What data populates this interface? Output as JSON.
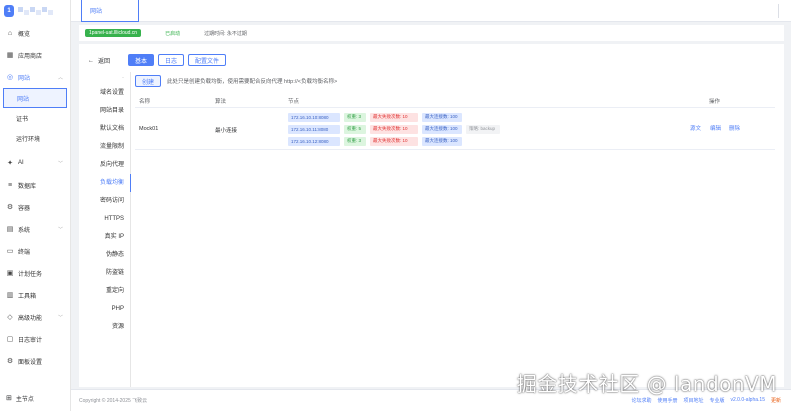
{
  "sidebar": {
    "logo_text": "1",
    "items": [
      {
        "label": "概览",
        "icon": "home-icon"
      },
      {
        "label": "应用商店",
        "icon": "grid-icon"
      },
      {
        "label": "网站",
        "icon": "globe-icon",
        "expanded": true
      }
    ],
    "sub_items": [
      {
        "label": "网站",
        "active": true
      },
      {
        "label": "证书",
        "active": false
      },
      {
        "label": "运行环境",
        "active": false
      }
    ],
    "items_after": [
      {
        "label": "AI",
        "icon": "ai-icon",
        "has_chevron": true
      },
      {
        "label": "数据库",
        "icon": "database-icon",
        "has_chevron": false
      },
      {
        "label": "容器",
        "icon": "container-icon",
        "has_chevron": false
      },
      {
        "label": "系统",
        "icon": "system-icon",
        "has_chevron": true
      },
      {
        "label": "终端",
        "icon": "terminal-icon",
        "has_chevron": false
      },
      {
        "label": "计划任务",
        "icon": "calendar-icon",
        "has_chevron": false
      },
      {
        "label": "工具箱",
        "icon": "toolbox-icon",
        "has_chevron": false
      },
      {
        "label": "高级功能",
        "icon": "diamond-icon",
        "has_chevron": true
      },
      {
        "label": "日志审计",
        "icon": "log-icon",
        "has_chevron": false
      },
      {
        "label": "面板设置",
        "icon": "settings-icon",
        "has_chevron": false
      }
    ],
    "node_label": "主节点"
  },
  "topbar": {
    "tab_label": "网站"
  },
  "infobar": {
    "site_name": "1panel-uat.lllicloud.cn",
    "status": "已启动",
    "expire": "过期时间: 永不过期"
  },
  "panel": {
    "back_label": "返回",
    "tabs": [
      {
        "label": "基本",
        "active": true
      },
      {
        "label": "日志",
        "active": false
      },
      {
        "label": "配置文件",
        "active": false
      }
    ],
    "menu_dot": "·",
    "menu": [
      {
        "label": "域名设置",
        "active": false
      },
      {
        "label": "网站目录",
        "active": false
      },
      {
        "label": "默认文档",
        "active": false
      },
      {
        "label": "流量限制",
        "active": false
      },
      {
        "label": "反向代理",
        "active": false
      },
      {
        "label": "负载均衡",
        "active": true
      },
      {
        "label": "密码访问",
        "active": false
      },
      {
        "label": "HTTPS",
        "active": false
      },
      {
        "label": "真实 IP",
        "active": false
      },
      {
        "label": "伪静态",
        "active": false
      },
      {
        "label": "防盗链",
        "active": false
      },
      {
        "label": "重定向",
        "active": false
      },
      {
        "label": "PHP",
        "active": false
      },
      {
        "label": "资源",
        "active": false
      }
    ],
    "create_button": "创建",
    "hint": "此处只是创建负载均衡，使用需要配合反向代理 http://<负载均衡名称>",
    "columns": {
      "name": "名称",
      "algorithm": "算法",
      "nodes": "节点",
      "actions": "操作"
    },
    "rows": [
      {
        "name": "Mock01",
        "algorithm": "最小连接",
        "nodes": [
          {
            "ip": "172.16.10.10:8080",
            "weight": "权重: 3",
            "max_fails": "最大失败次数: 10",
            "max_conns": "最大连接数: 100",
            "backup": ""
          },
          {
            "ip": "172.16.10.11:8080",
            "weight": "权重: 5",
            "max_fails": "最大失败次数: 10",
            "max_conns": "最大连接数: 100",
            "backup": "策略: backup"
          },
          {
            "ip": "172.16.10.12:8080",
            "weight": "权重: 3",
            "max_fails": "最大失败次数: 10",
            "max_conns": "最大连接数: 100",
            "backup": ""
          }
        ],
        "actions": [
          "源文",
          "编辑",
          "删除"
        ]
      }
    ]
  },
  "footer": {
    "copyright": "Copyright © 2014-2025 飞致云",
    "links": [
      "论坛求助",
      "使用手册",
      "项目地址",
      "专业版"
    ],
    "version": "v2.0.0-alpha.15",
    "update": "更新"
  },
  "watermark": "掘金技术社区 @ landonVM",
  "colors": {
    "accent": "#4f7ef7",
    "success": "#37b24d",
    "danger": "#e03131"
  }
}
